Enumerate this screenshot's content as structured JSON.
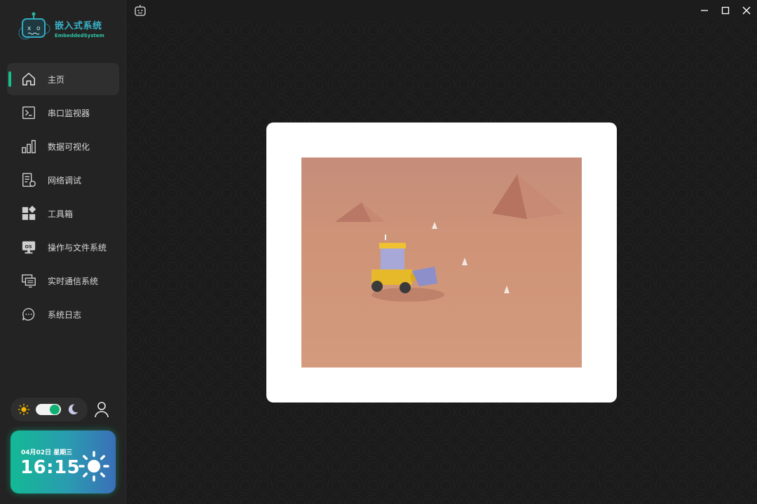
{
  "app": {
    "title": "嵌入式系统",
    "subtitle": "EmbeddedSystem"
  },
  "sidebar": {
    "items": [
      {
        "label": "主页",
        "icon": "home-icon",
        "active": true
      },
      {
        "label": "串口监视器",
        "icon": "terminal-icon",
        "active": false
      },
      {
        "label": "数据可视化",
        "icon": "bar-chart-icon",
        "active": false
      },
      {
        "label": "网络调试",
        "icon": "network-server-icon",
        "active": false
      },
      {
        "label": "工具箱",
        "icon": "apps-grid-icon",
        "active": false
      },
      {
        "label": "操作与文件系统",
        "icon": "os-monitor-icon",
        "active": false
      },
      {
        "label": "实时通信系统",
        "icon": "devices-icon",
        "active": false
      },
      {
        "label": "系统日志",
        "icon": "chat-bubble-icon",
        "active": false
      }
    ]
  },
  "theme": {
    "mode": "dark",
    "toggle_on": true
  },
  "clock": {
    "date": "04月02日",
    "weekday": "星期三",
    "time": "16:15",
    "weather_icon": "sun-icon"
  },
  "colors": {
    "accent": "#16c08c",
    "sidebar_bg": "#232323",
    "main_bg": "#1b1b1b",
    "card_bg": "#ffffff",
    "clock_gradient_start": "#13b995",
    "clock_gradient_end": "#3a6fb8"
  }
}
